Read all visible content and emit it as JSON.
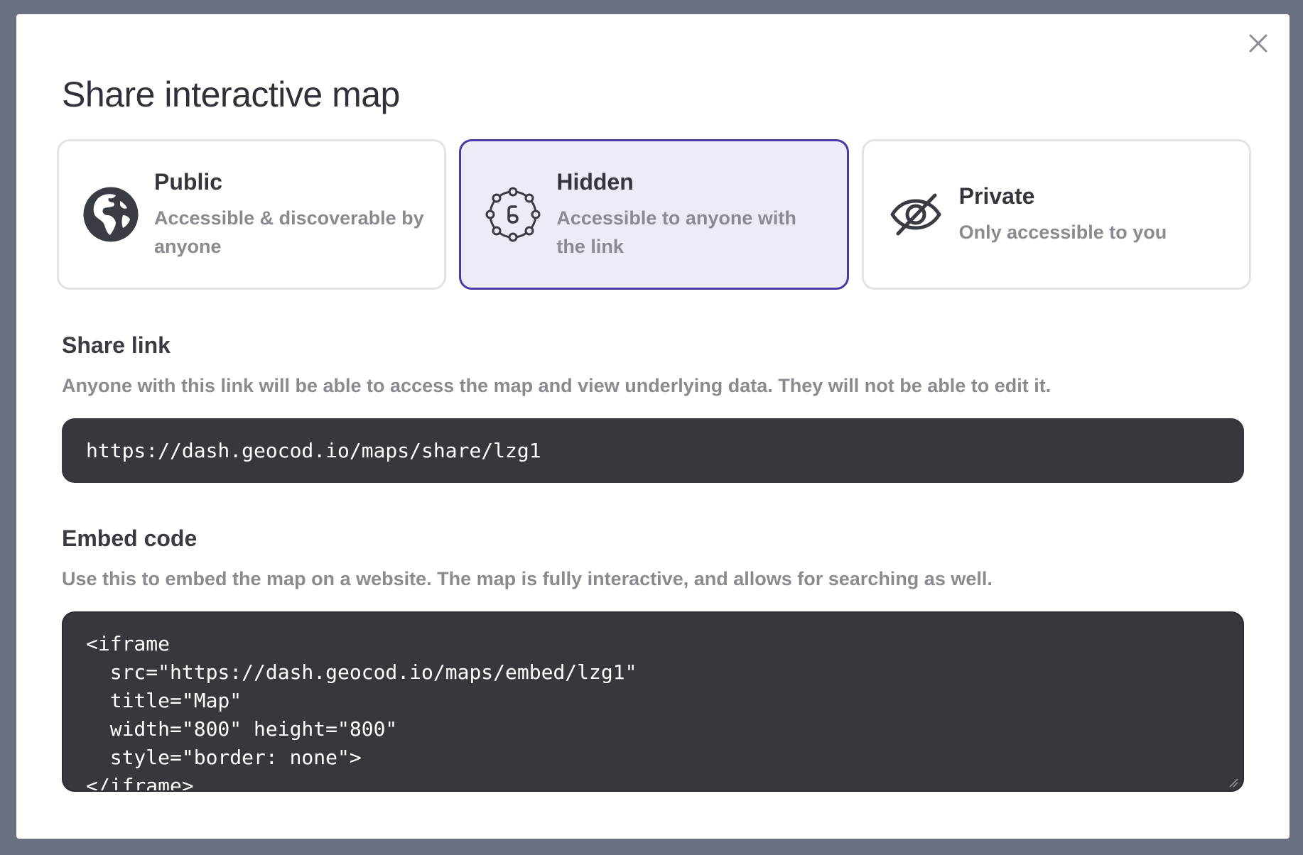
{
  "modal": {
    "title": "Share interactive map",
    "close_icon": "close-icon"
  },
  "visibility": {
    "selected": "hidden",
    "options": [
      {
        "id": "public",
        "label": "Public",
        "description": "Accessible & discoverable by anyone",
        "icon": "globe-icon"
      },
      {
        "id": "hidden",
        "label": "Hidden",
        "description": "Accessible to anyone with the link",
        "icon": "link-circle-icon"
      },
      {
        "id": "private",
        "label": "Private",
        "description": "Only accessible to you",
        "icon": "eye-slash-icon"
      }
    ]
  },
  "share_link": {
    "title": "Share link",
    "description": "Anyone with this link will be able to access the map and view underlying data. They will not be able to edit it.",
    "url": "https://dash.geocod.io/maps/share/lzg1"
  },
  "embed": {
    "title": "Embed code",
    "description": "Use this to embed the map on a website. The map is fully interactive, and allows for searching as well.",
    "code": "<iframe\n  src=\"https://dash.geocod.io/maps/embed/lzg1\"\n  title=\"Map\"\n  width=\"800\" height=\"800\"\n  style=\"border: none\">\n</iframe>"
  },
  "colors": {
    "backdrop": "#6b7180",
    "accent": "#4b3aa3",
    "selected_bg": "#ececf6",
    "code_bg": "#37383e"
  }
}
